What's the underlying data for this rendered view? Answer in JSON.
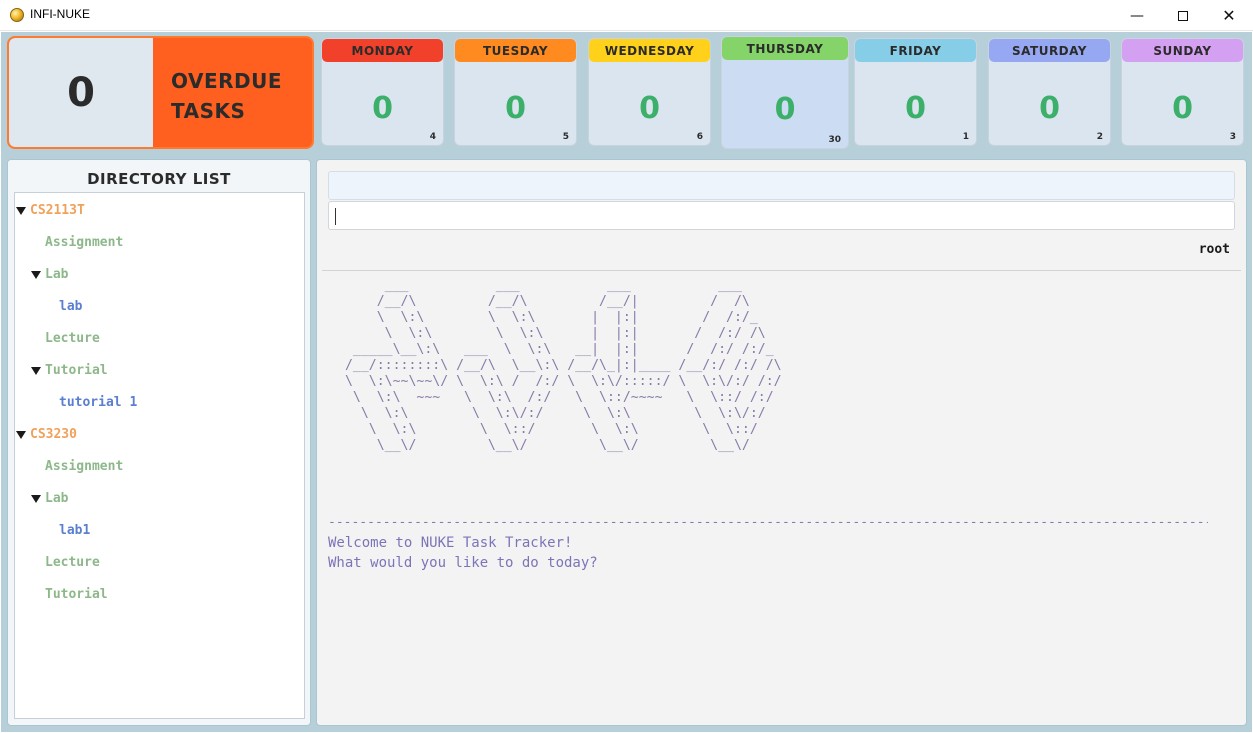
{
  "window": {
    "title": "INFI-NUKE",
    "minimize_glyph": "—",
    "close_glyph": "✕"
  },
  "overdue": {
    "count": "0",
    "label_line1": "OVERDUE",
    "label_line2": "TASKS",
    "color": "#ff5f1f"
  },
  "days": [
    {
      "name": "MONDAY",
      "count": "0",
      "date": "4",
      "color": "#f2412b"
    },
    {
      "name": "TUESDAY",
      "count": "0",
      "date": "5",
      "color": "#ff8a1f"
    },
    {
      "name": "WEDNESDAY",
      "count": "0",
      "date": "6",
      "color": "#ffd11a"
    },
    {
      "name": "THURSDAY",
      "count": "0",
      "date": "30",
      "color": "#84d46a",
      "today": true
    },
    {
      "name": "FRIDAY",
      "count": "0",
      "date": "1",
      "color": "#86cde8"
    },
    {
      "name": "SATURDAY",
      "count": "0",
      "date": "2",
      "color": "#97a8f2"
    },
    {
      "name": "SUNDAY",
      "count": "0",
      "date": "3",
      "color": "#d4a0f2"
    }
  ],
  "directory": {
    "title": "DIRECTORY LIST",
    "items": [
      {
        "label": "CS2113T",
        "level": "module",
        "expanded": true
      },
      {
        "label": "Assignment",
        "level": "category"
      },
      {
        "label": "Lab",
        "level": "category",
        "expanded": true
      },
      {
        "label": "lab",
        "level": "task"
      },
      {
        "label": "Lecture",
        "level": "category"
      },
      {
        "label": "Tutorial",
        "level": "category",
        "expanded": true
      },
      {
        "label": "tutorial 1",
        "level": "task"
      },
      {
        "label": "CS3230",
        "level": "module",
        "expanded": true
      },
      {
        "label": "Assignment",
        "level": "category"
      },
      {
        "label": "Lab",
        "level": "category",
        "expanded": true
      },
      {
        "label": "lab1",
        "level": "task"
      },
      {
        "label": "Lecture",
        "level": "category"
      },
      {
        "label": "Tutorial",
        "level": "category"
      }
    ],
    "level_colors": {
      "module": "#f0a15a",
      "category": "#8db88a",
      "task": "#5b7fd0"
    }
  },
  "console": {
    "output_text": "",
    "input_value": "",
    "path": "root",
    "ascii_art": "      ___           ___           ___           ___\n     /__/\\         /__/\\         /__/|         /  /\\\n     \\  \\:\\        \\  \\:\\       |  |:|        /  /:/_\n      \\  \\:\\        \\  \\:\\      |  |:|       /  /:/ /\\\n  _____\\__\\:\\   ___  \\  \\:\\   __|  |:|      /  /:/ /:/_\n /__/::::::::\\ /__/\\  \\__\\:\\ /__/\\_|:|____ /__/:/ /:/ /\\\n \\  \\:\\~~\\~~\\/ \\  \\:\\ /  /:/ \\  \\:\\/:::::/ \\  \\:\\/:/ /:/\n  \\  \\:\\  ~~~   \\  \\:\\  /:/   \\  \\::/~~~~   \\  \\::/ /:/\n   \\  \\:\\        \\  \\:\\/:/     \\  \\:\\        \\  \\:\\/:/\n    \\  \\:\\        \\  \\::/       \\  \\:\\        \\  \\::/\n     \\__\\/         \\__\\/         \\__\\/         \\__\\/",
    "separator": "-----------------------------------------------------------------------------------------------------------------------",
    "welcome_line1": "Welcome to NUKE Task Tracker!",
    "welcome_line2": "What would you like to do today?"
  }
}
